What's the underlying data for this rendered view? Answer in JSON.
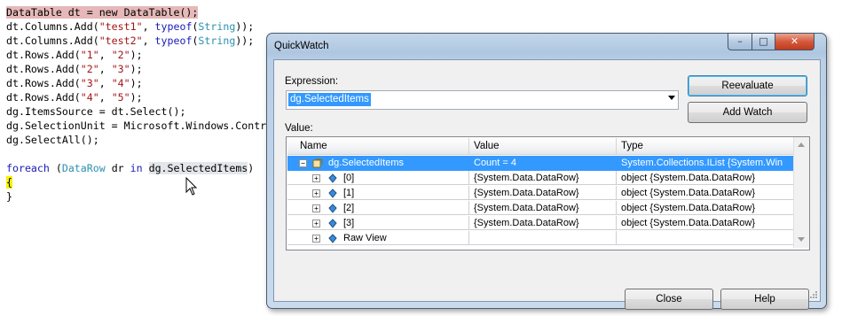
{
  "editor": {
    "lines": [
      {
        "plain": "DataTable dt = new DataTable();"
      },
      {
        "pre": "dt.Columns.Add(",
        "s1": "\"test1\"",
        "mid": ", ",
        "kw": "typeof",
        "p2": "(",
        "ty": "String",
        "post": "));"
      },
      {
        "pre": "dt.Columns.Add(",
        "s1": "\"test2\"",
        "mid": ", ",
        "kw": "typeof",
        "p2": "(",
        "ty": "String",
        "post": "));"
      },
      {
        "pre": "dt.Rows.Add(",
        "s1": "\"1\"",
        "mid": ", ",
        "s2": "\"2\"",
        "post": ");"
      },
      {
        "pre": "dt.Rows.Add(",
        "s1": "\"2\"",
        "mid": ", ",
        "s2": "\"3\"",
        "post": ");"
      },
      {
        "pre": "dt.Rows.Add(",
        "s1": "\"3\"",
        "mid": ", ",
        "s2": "\"4\"",
        "post": ");"
      },
      {
        "pre": "dt.Rows.Add(",
        "s1": "\"4\"",
        "mid": ", ",
        "s2": "\"5\"",
        "post": ");"
      },
      {
        "plain": "dg.ItemsSource = dt.Select();"
      },
      {
        "plain": "dg.SelectionUnit = Microsoft.Windows.Contr"
      },
      {
        "plain": "dg.SelectAll();"
      },
      {
        "kw": "foreach",
        "a": " (",
        "ty": "DataRow",
        "b": " dr ",
        "kw2": "in",
        "c": " ",
        "sel": "dg.SelectedItems",
        "d": ")"
      },
      {
        "plain": "{"
      },
      {
        "plain": "}"
      }
    ]
  },
  "quickwatch": {
    "title": "QuickWatch",
    "min_glyph": "–",
    "max_glyph": "□",
    "close_glyph": "✕",
    "expression_label": "Expression:",
    "expression_value": "dg.SelectedItems",
    "reevaluate_label": "Reevaluate",
    "add_watch_label": "Add Watch",
    "value_label": "Value:",
    "columns": {
      "name": "Name",
      "value": "Value",
      "type": "Type"
    },
    "rows": [
      {
        "expander": "−",
        "name": "dg.SelectedItems",
        "value": "Count = 4",
        "type": "System.Collections.IList {System.Win",
        "selected": true
      },
      {
        "expander": "+",
        "name": "[0]",
        "value": "{System.Data.DataRow}",
        "type": "object {System.Data.DataRow}"
      },
      {
        "expander": "+",
        "name": "[1]",
        "value": "{System.Data.DataRow}",
        "type": "object {System.Data.DataRow}"
      },
      {
        "expander": "+",
        "name": "[2]",
        "value": "{System.Data.DataRow}",
        "type": "object {System.Data.DataRow}"
      },
      {
        "expander": "+",
        "name": "[3]",
        "value": "{System.Data.DataRow}",
        "type": "object {System.Data.DataRow}"
      },
      {
        "expander": "+",
        "name": "Raw View",
        "value": "",
        "type": ""
      }
    ],
    "close_label": "Close",
    "help_label": "Help"
  },
  "colors": {
    "selection": "#3399ff",
    "keyword": "#1a1ab8",
    "type": "#2b91af",
    "string": "#a31515"
  }
}
